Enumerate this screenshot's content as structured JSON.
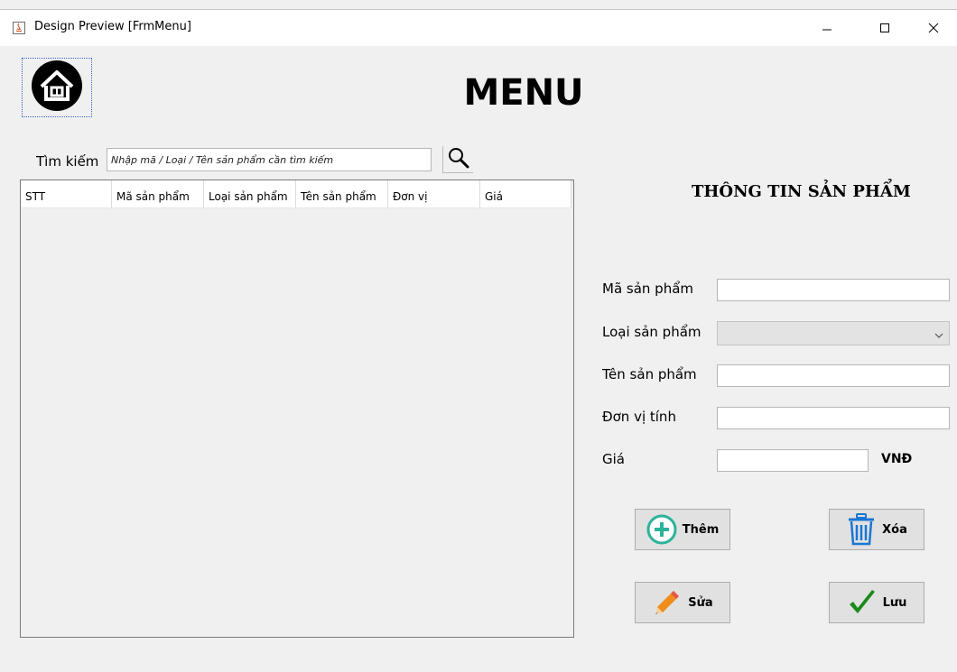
{
  "window": {
    "title": "Design Preview [FrmMenu]"
  },
  "header": {
    "title": "MENU"
  },
  "search": {
    "label": "Tìm kiếm",
    "placeholder": "Nhập mã / Loại / Tên sản phẩm cần tìm kiếm",
    "value": ""
  },
  "table": {
    "columns": [
      "STT",
      "Mã sản phẩm",
      "Loại sản phẩm",
      "Tên sản phẩm",
      "Đơn vị",
      "Giá"
    ],
    "rows": []
  },
  "form": {
    "title": "THÔNG TIN SẢN PHẨM",
    "fields": {
      "ma_san_pham": {
        "label": "Mã sản phẩm",
        "value": ""
      },
      "loai_san_pham": {
        "label": "Loại sản phẩm",
        "value": ""
      },
      "ten_san_pham": {
        "label": "Tên sản phẩm",
        "value": ""
      },
      "don_vi_tinh": {
        "label": "Đơn vị tính",
        "value": ""
      },
      "gia": {
        "label": "Giá",
        "value": "",
        "unit": "VNĐ"
      }
    }
  },
  "actions": {
    "add": "Thêm",
    "delete": "Xóa",
    "edit": "Sửa",
    "save": "Lưu"
  },
  "icons": {
    "home": "home-icon",
    "search": "magnifier-icon",
    "add": "plus-circle-icon",
    "delete": "trash-icon",
    "edit": "pencil-icon",
    "save": "checkmark-icon"
  },
  "colors": {
    "add_icon": "#2bb39a",
    "delete_icon": "#1976d2",
    "save_icon": "#1a8a1a",
    "pencil": "#f08c1c"
  }
}
